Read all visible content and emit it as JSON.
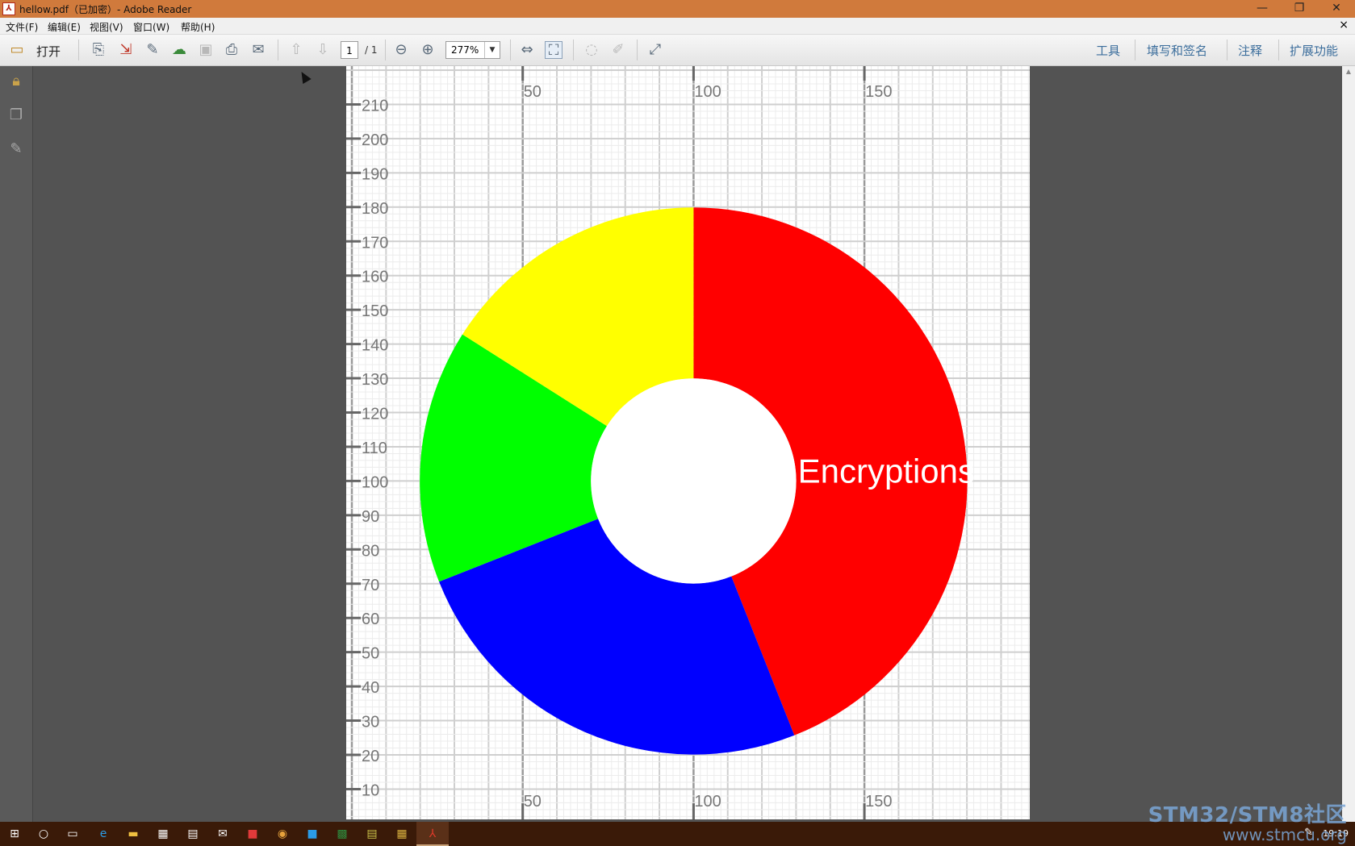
{
  "window": {
    "title": "hellow.pdf（已加密）- Adobe Reader",
    "minimize_glyph": "—",
    "restore_glyph": "❐",
    "close_glyph": "✕"
  },
  "menu": {
    "items": [
      {
        "label": "文件(F)"
      },
      {
        "label": "编辑(E)"
      },
      {
        "label": "视图(V)"
      },
      {
        "label": "窗口(W)"
      },
      {
        "label": "帮助(H)"
      }
    ],
    "doc_close": "×"
  },
  "toolbar": {
    "open_label": "打开",
    "page_current": "1",
    "page_total": "/ 1",
    "zoom": "277%",
    "zoom_dropdown_glyph": "▼",
    "links": [
      "工具",
      "填写和签名",
      "注释",
      "扩展功能"
    ]
  },
  "chart_data": {
    "type": "pie",
    "title": "",
    "labels": [
      "Encryptions",
      "",
      "",
      ""
    ],
    "values": [
      44,
      25,
      15,
      16
    ],
    "colors": [
      "#ff0000",
      "#0000ff",
      "#00ff00",
      "#ffff00"
    ],
    "inner_radius_ratio": 0.375,
    "center": {
      "x": 100,
      "y": 100
    },
    "outer_radius": 80,
    "axis": {
      "x_ticks": [
        "50",
        "100",
        "150"
      ],
      "y_ticks": [
        "10",
        "20",
        "30",
        "40",
        "50",
        "60",
        "70",
        "80",
        "90",
        "100",
        "110",
        "120",
        "130",
        "140",
        "150",
        "160",
        "170",
        "180",
        "190",
        "200",
        "210"
      ],
      "xlim": [
        0,
        200
      ],
      "ylim": [
        0,
        220
      ]
    },
    "grid": true
  },
  "taskbar": {
    "clock": "19:19"
  },
  "watermark": {
    "line1": "STM32/STM8社区",
    "line2": "www.stmcu.org"
  }
}
